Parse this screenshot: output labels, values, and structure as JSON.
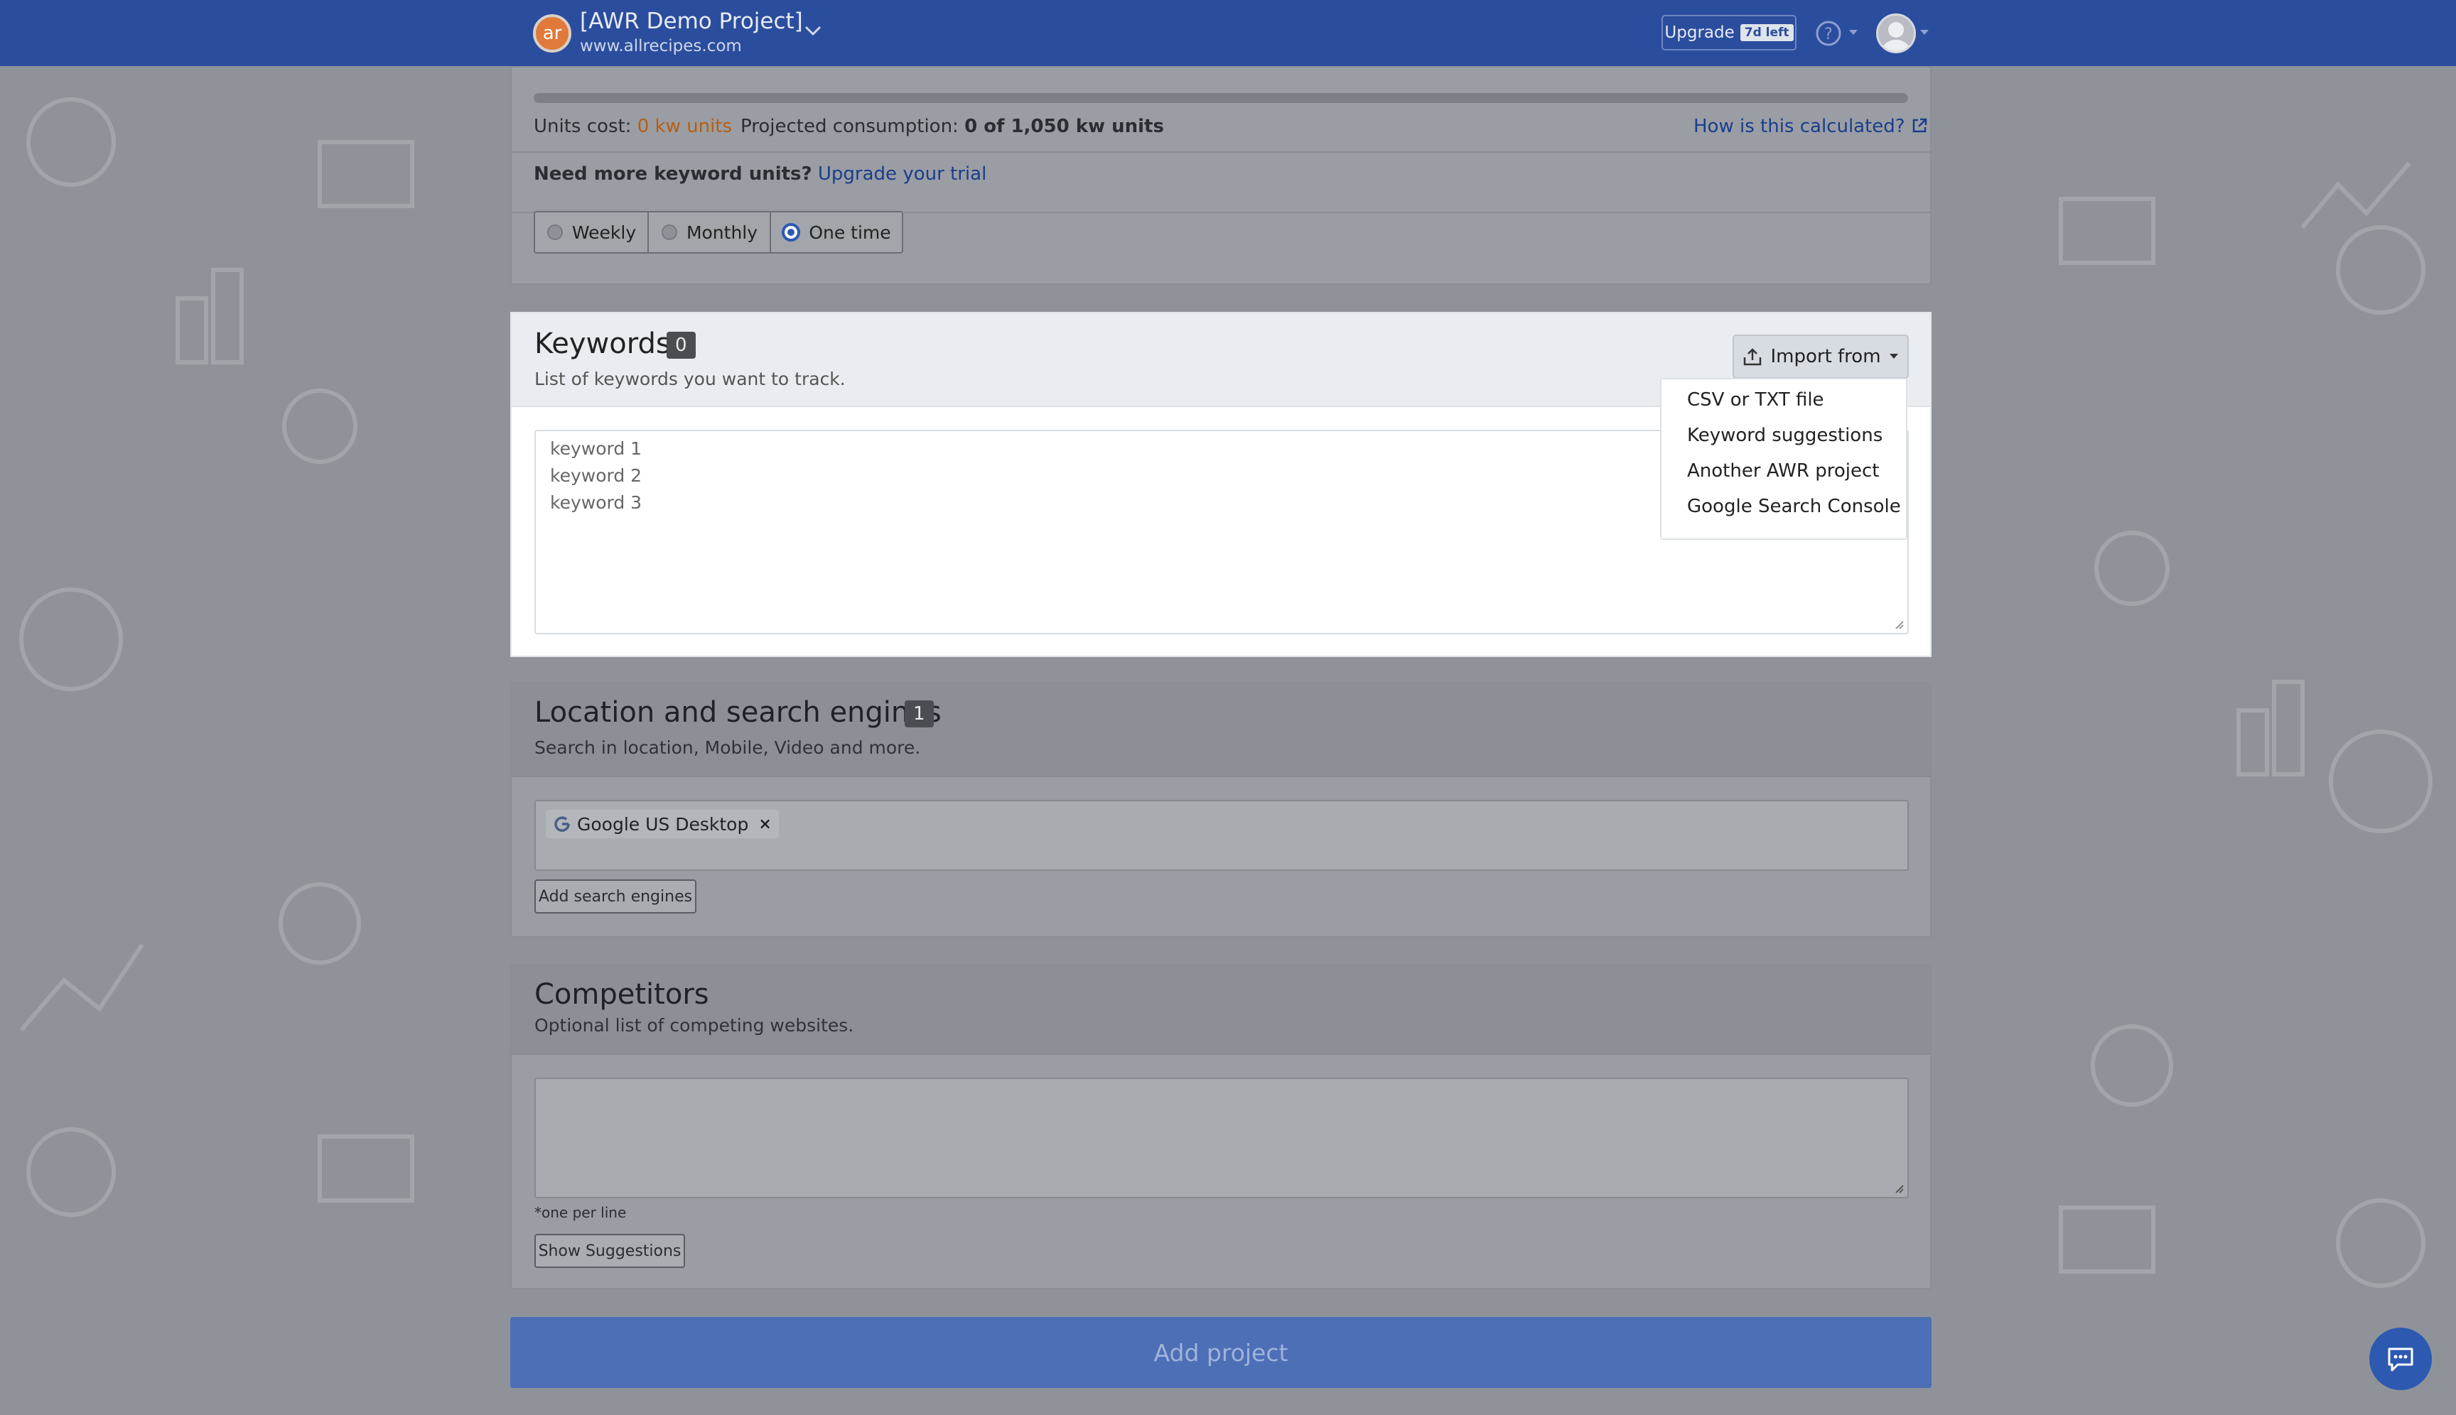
{
  "navbar": {
    "logo_text": "ar",
    "project_name": "[AWR Demo Project]",
    "project_url": "www.allrecipes.com",
    "upgrade_label": "Upgrade",
    "trial_badge": "7d left"
  },
  "units": {
    "cost_label": "Units cost:",
    "cost_value": "0 kw units",
    "projected_label": "Projected consumption:",
    "projected_value": "0 of 1,050 kw units",
    "calc_link": "How is this calculated?",
    "need_more": "Need more keyword units?",
    "upgrade_link": "Upgrade your trial"
  },
  "frequency": {
    "options": [
      "Weekly",
      "Monthly",
      "One time"
    ],
    "selected": "One time"
  },
  "keywords": {
    "title": "Keywords",
    "count": "0",
    "subtitle": "List of keywords you want to track.",
    "import_label": "Import from",
    "placeholder_lines": [
      "keyword 1",
      "keyword 2",
      "keyword 3"
    ],
    "import_menu": [
      "CSV or TXT file",
      "Keyword suggestions",
      "Another AWR project",
      "Google Search Console"
    ]
  },
  "location": {
    "title": "Location and search engines",
    "count": "1",
    "subtitle": "Search in location, Mobile, Video and more.",
    "engine_tag": "Google US Desktop",
    "add_button": "Add search engines"
  },
  "competitors": {
    "title": "Competitors",
    "subtitle": "Optional list of competing websites.",
    "hint": "*one per line",
    "suggest_button": "Show Suggestions"
  },
  "footer": {
    "add_project": "Add project"
  },
  "colors": {
    "navbar": "#2b4d9e",
    "accent": "#2d59b0",
    "orange": "#b85e12"
  }
}
